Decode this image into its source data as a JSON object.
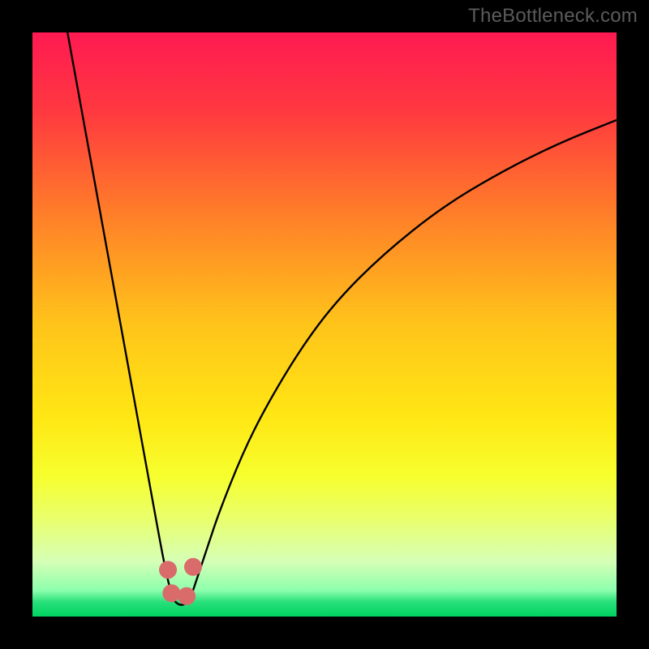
{
  "watermark": "TheBottleneck.com",
  "chart_data": {
    "type": "line",
    "title": "",
    "xlabel": "",
    "ylabel": "",
    "xlim": [
      0,
      100
    ],
    "ylim": [
      0,
      100
    ],
    "grid": false,
    "series": [
      {
        "name": "bottleneck-curve",
        "x": [
          6,
          8,
          10,
          12,
          14,
          16,
          18,
          20,
          22,
          23,
          24,
          25,
          26,
          27,
          28,
          30,
          32,
          36,
          40,
          46,
          52,
          60,
          70,
          80,
          90,
          100
        ],
        "y": [
          100,
          89,
          78,
          67,
          56,
          45,
          34,
          23,
          12,
          7,
          3,
          2,
          2,
          3,
          6,
          12,
          18,
          28,
          36,
          46,
          54,
          62,
          70,
          76,
          81,
          85
        ]
      }
    ],
    "markers": [
      {
        "name": "dot-left-upper",
        "x": 23.2,
        "y": 8.0
      },
      {
        "name": "dot-left-lower",
        "x": 23.8,
        "y": 4.0
      },
      {
        "name": "dot-right-lower",
        "x": 26.4,
        "y": 3.5
      },
      {
        "name": "dot-right-upper",
        "x": 27.5,
        "y": 8.5
      }
    ],
    "background": {
      "type": "vertical-gradient",
      "stops": [
        {
          "pos": 0.0,
          "color": "#ff1a52"
        },
        {
          "pos": 0.14,
          "color": "#ff3a3f"
        },
        {
          "pos": 0.3,
          "color": "#ff7a2a"
        },
        {
          "pos": 0.5,
          "color": "#ffc41a"
        },
        {
          "pos": 0.66,
          "color": "#ffe714"
        },
        {
          "pos": 0.76,
          "color": "#f6ff2e"
        },
        {
          "pos": 0.83,
          "color": "#eaff6a"
        },
        {
          "pos": 0.905,
          "color": "#d6ffb6"
        },
        {
          "pos": 0.955,
          "color": "#8dffad"
        },
        {
          "pos": 0.975,
          "color": "#28e07a"
        },
        {
          "pos": 1.0,
          "color": "#00d362"
        }
      ]
    },
    "marker_color": "#d96b6b",
    "line_color": "#000000"
  }
}
